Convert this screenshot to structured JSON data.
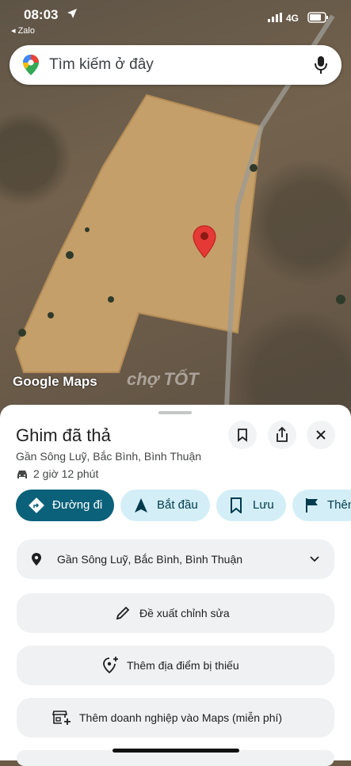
{
  "status": {
    "time": "08:03",
    "back_app": "◂ Zalo",
    "network": "4G"
  },
  "search": {
    "placeholder": "Tìm kiếm ở đây"
  },
  "map": {
    "attribution": "Google Maps",
    "watermark": "chợ TỐT"
  },
  "place": {
    "title": "Ghim đã thả",
    "address": "Gần Sông Luỹ, Bắc Bình, Bình Thuận",
    "drive_time": "2 giờ 12 phút"
  },
  "actions": {
    "directions": "Đường đi",
    "start": "Bắt đầu",
    "save": "Lưu",
    "add_label": "Thêm"
  },
  "details": {
    "address_row": "Gần Sông Luỹ, Bắc Bình, Bình Thuận",
    "suggest_edit": "Đề xuất chỉnh sửa",
    "add_missing_place": "Thêm địa điểm bị thiếu",
    "add_business": "Thêm doanh nghiệp vào Maps (miễn phí)"
  },
  "colors": {
    "primary_chip": "#0b6179",
    "chip": "#d3eef6",
    "pin": "#e53935"
  }
}
